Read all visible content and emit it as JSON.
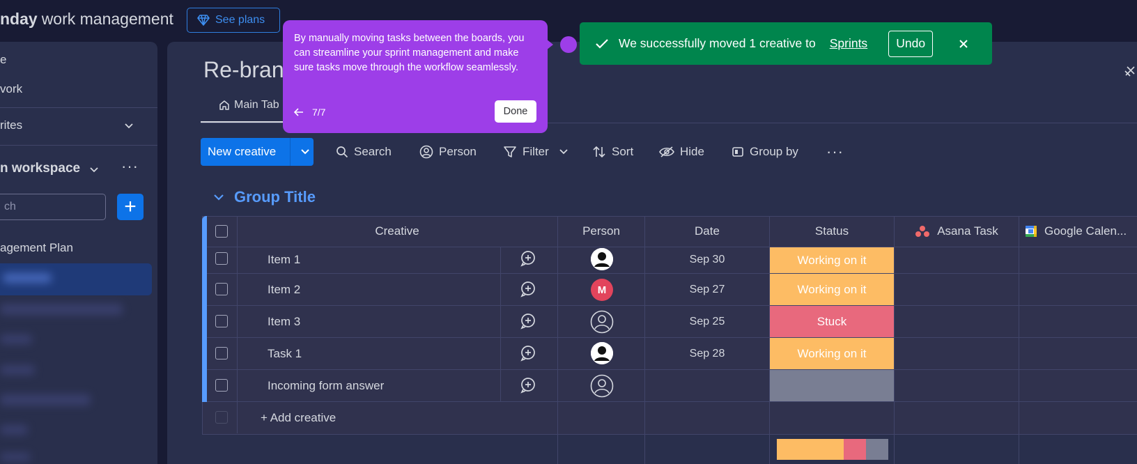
{
  "header": {
    "brand_bold": "nday",
    "brand_rest": "work management",
    "see_plans": "See plans"
  },
  "sidebar": {
    "item_top1": "e",
    "item_top2": "vork",
    "favorites": "rites",
    "workspace": "n workspace",
    "search_placeholder": "ch",
    "plan": "agement Plan"
  },
  "board": {
    "title": "Re-bran",
    "tab_main": "Main Tab"
  },
  "toolbar": {
    "new_item": "New creative",
    "search": "Search",
    "person": "Person",
    "filter": "Filter",
    "sort": "Sort",
    "hide": "Hide",
    "group_by": "Group by"
  },
  "group": {
    "title": "Group Title",
    "color": "#579bfc"
  },
  "columns": [
    "Creative",
    "Person",
    "Date",
    "Status",
    "Asana Task",
    "Google Calen..."
  ],
  "rows": [
    {
      "name": "Item 1",
      "person": "dark-avatar",
      "date": "Sep 30",
      "status": "Working on it",
      "status_color": "#fdbc64"
    },
    {
      "name": "Item 2",
      "person": "M",
      "date": "Sep 27",
      "status": "Working on it",
      "status_color": "#fdbc64"
    },
    {
      "name": "Item 3",
      "person": "empty",
      "date": "Sep 25",
      "status": "Stuck",
      "status_color": "#e8697d"
    },
    {
      "name": "Task 1",
      "person": "dark-avatar",
      "date": "Sep 28",
      "status": "Working on it",
      "status_color": "#fdbc64"
    },
    {
      "name": "Incoming form answer",
      "person": "empty",
      "date": "",
      "status": "",
      "status_color": "#797e93"
    }
  ],
  "add_item": "+ Add creative",
  "status_summary": [
    {
      "color": "#fdbc64",
      "fraction": 0.6
    },
    {
      "color": "#e8697d",
      "fraction": 0.2
    },
    {
      "color": "#797e93",
      "fraction": 0.2
    }
  ],
  "tooltip": {
    "text": "By manually moving tasks between the boards, you can streamline your sprint management and make sure tasks move through the workflow seamlessly.",
    "step": "7/7",
    "done": "Done"
  },
  "toast": {
    "message": "We successfully moved 1 creative to",
    "link": "Sprints",
    "undo": "Undo"
  }
}
